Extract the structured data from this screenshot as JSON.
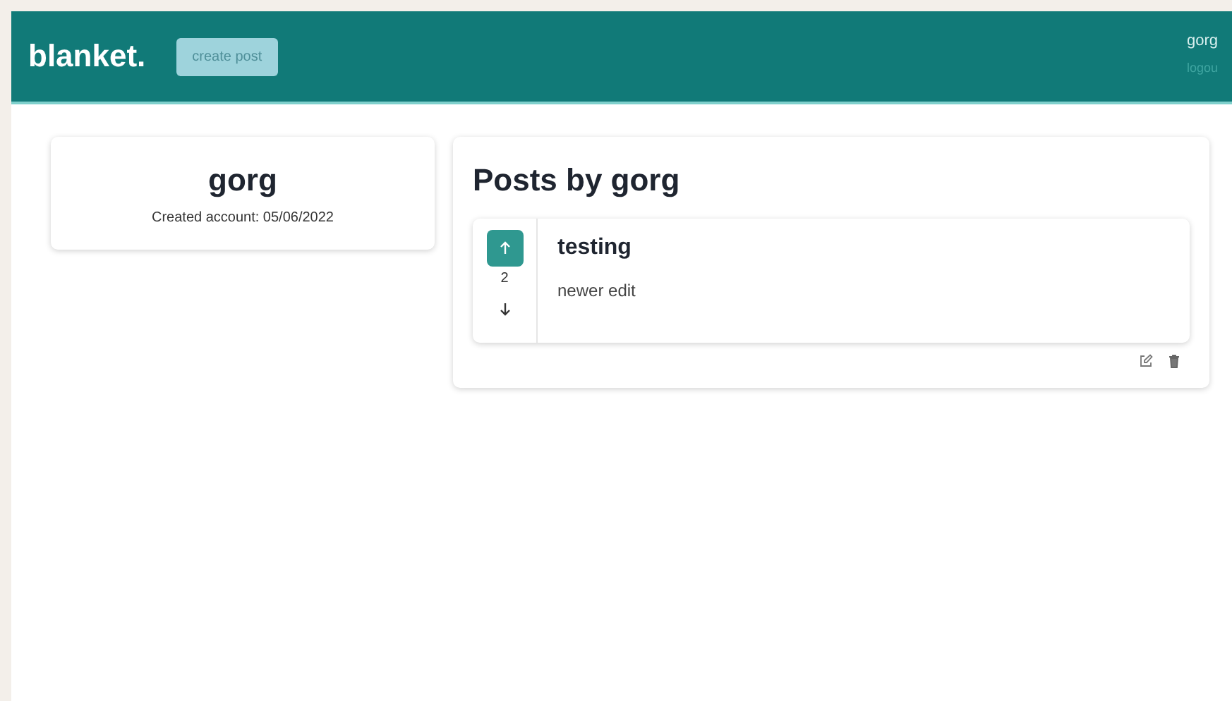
{
  "header": {
    "logo": "blanket.",
    "create_button": "create post",
    "username": "gorg",
    "logout": "logou"
  },
  "profile": {
    "name": "gorg",
    "created": "Created account: 05/06/2022"
  },
  "posts_panel": {
    "title": "Posts by gorg",
    "posts": [
      {
        "title": "testing",
        "body": "newer edit",
        "score": "2",
        "upvoted": true,
        "downvoted": false
      }
    ]
  }
}
